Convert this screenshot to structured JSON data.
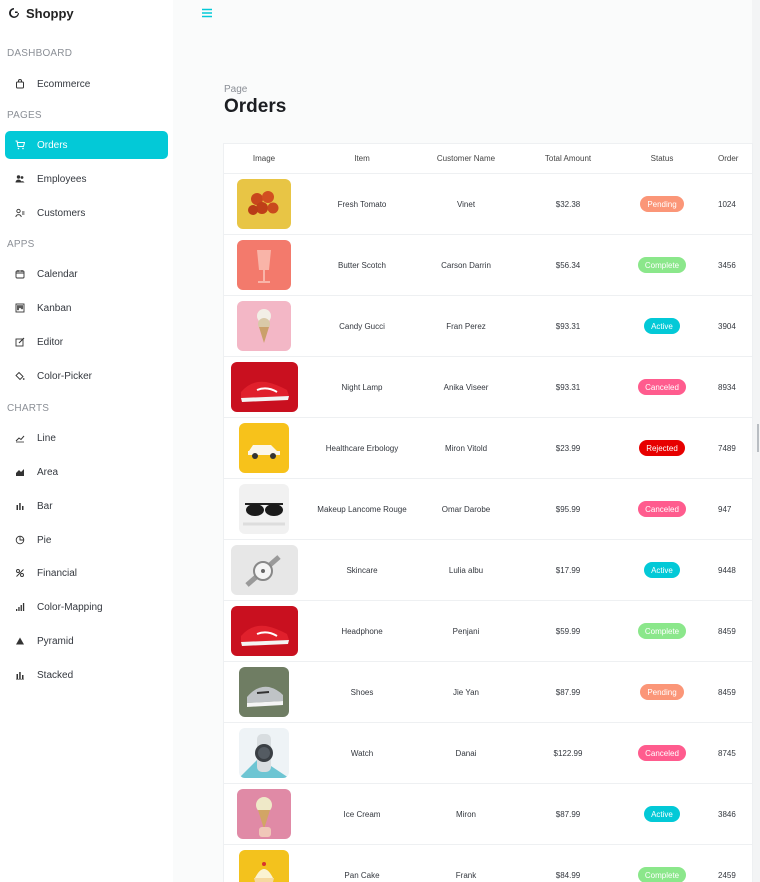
{
  "app": {
    "brand": "Shoppy"
  },
  "sidebar": {
    "sections": {
      "dashboard": "DASHBOARD",
      "pages": "PAGES",
      "apps": "APPS",
      "charts": "CHARTS"
    },
    "items": {
      "ecommerce": "Ecommerce",
      "orders": "Orders",
      "employees": "Employees",
      "customers": "Customers",
      "calendar": "Calendar",
      "kanban": "Kanban",
      "editor": "Editor",
      "colorpicker": "Color-Picker",
      "line": "Line",
      "area": "Area",
      "bar": "Bar",
      "pie": "Pie",
      "financial": "Financial",
      "colormapping": "Color-Mapping",
      "pyramid": "Pyramid",
      "stacked": "Stacked"
    },
    "active_item": "Orders",
    "accent_color": "#03c9d7"
  },
  "page": {
    "subtitle": "Page",
    "title": "Orders"
  },
  "table": {
    "columns": {
      "image": "Image",
      "item": "Item",
      "customer": "Customer Name",
      "amount": "Total Amount",
      "status": "Status",
      "order": "Order"
    },
    "rows": [
      {
        "item": "Fresh Tomato",
        "customer": "Vinet",
        "amount": "$32.38",
        "status": "Pending",
        "order": "1024",
        "status_color": "#fb9678",
        "thumb": "tomato"
      },
      {
        "item": "Butter Scotch",
        "customer": "Carson Darrin",
        "amount": "$56.34",
        "status": "Complete",
        "order": "3456",
        "status_color": "#8be78b",
        "thumb": "cup"
      },
      {
        "item": "Candy Gucci",
        "customer": "Fran Perez",
        "amount": "$93.31",
        "status": "Active",
        "order": "3904",
        "status_color": "#03c9d7",
        "thumb": "icecream-pink"
      },
      {
        "item": "Night Lamp",
        "customer": "Anika Viseer",
        "amount": "$93.31",
        "status": "Canceled",
        "order": "8934",
        "status_color": "#ff5c8e",
        "thumb": "red-shoe"
      },
      {
        "item": "Healthcare Erbology",
        "customer": "Miron Vitold",
        "amount": "$23.99",
        "status": "Rejected",
        "order": "7489",
        "status_color": "#e70000",
        "thumb": "car"
      },
      {
        "item": "Makeup Lancome Rouge",
        "customer": "Omar Darobe",
        "amount": "$95.99",
        "status": "Canceled",
        "order": "947",
        "status_color": "#ff5c8e",
        "thumb": "sunglasses"
      },
      {
        "item": "Skincare",
        "customer": "Lulia albu",
        "amount": "$17.99",
        "status": "Active",
        "order": "9448",
        "status_color": "#03c9d7",
        "thumb": "watch"
      },
      {
        "item": "Headphone",
        "customer": "Penjani",
        "amount": "$59.99",
        "status": "Complete",
        "order": "8459",
        "status_color": "#8be78b",
        "thumb": "red-shoe"
      },
      {
        "item": "Shoes",
        "customer": "Jie Yan",
        "amount": "$87.99",
        "status": "Pending",
        "order": "8459",
        "status_color": "#fb9678",
        "thumb": "grey-shoe"
      },
      {
        "item": "Watch",
        "customer": "Danai",
        "amount": "$122.99",
        "status": "Canceled",
        "order": "8745",
        "status_color": "#ff5c8e",
        "thumb": "smartwatch"
      },
      {
        "item": "Ice Cream",
        "customer": "Miron",
        "amount": "$87.99",
        "status": "Active",
        "order": "3846",
        "status_color": "#03c9d7",
        "thumb": "icecream-hand"
      },
      {
        "item": "Pan Cake",
        "customer": "Frank",
        "amount": "$84.99",
        "status": "Complete",
        "order": "2459",
        "status_color": "#8be78b",
        "thumb": "cupcake"
      }
    ]
  }
}
